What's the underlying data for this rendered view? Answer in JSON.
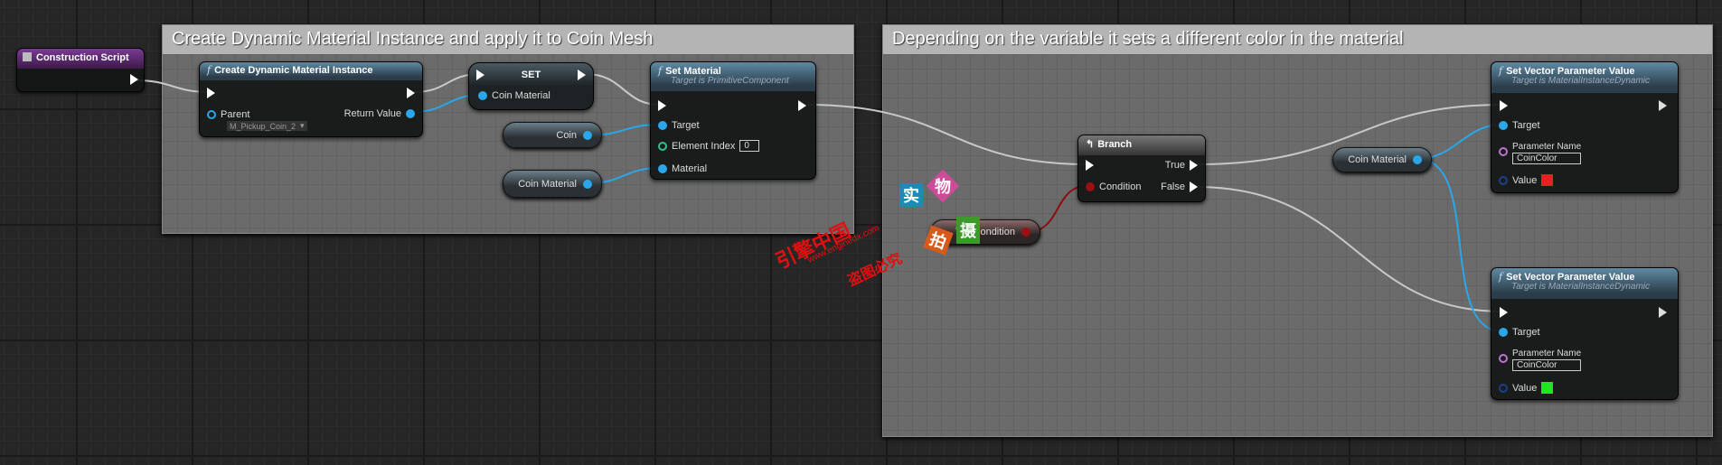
{
  "comments": [
    {
      "title": "Create Dynamic Material Instance and apply it to Coin Mesh"
    },
    {
      "title": "Depending on the variable it sets a different color in the material"
    }
  ],
  "nodes": {
    "construction_script": {
      "title": "Construction Script",
      "color": "#6a2a82"
    },
    "create_dmi": {
      "title": "Create Dynamic Material Instance",
      "parent_label": "Parent",
      "parent_value": "M_Pickup_Coin_2",
      "return_label": "Return Value"
    },
    "set": {
      "title": "SET",
      "pin": "Coin Material"
    },
    "coin_var": {
      "label": "Coin"
    },
    "coin_material_var": {
      "label": "Coin Material"
    },
    "set_material": {
      "title": "Set Material",
      "subtitle": "Target is PrimitiveComponent",
      "target": "Target",
      "element_index": "Element Index",
      "element_index_value": "0",
      "material": "Material"
    },
    "branch": {
      "title": "Branch",
      "true": "True",
      "false": "False",
      "condition": "Condition"
    },
    "var_condition": {
      "label": "Var Condition"
    },
    "coin_material_var2": {
      "label": "Coin Material"
    },
    "svpv_red": {
      "title": "Set Vector Parameter Value",
      "subtitle": "Target is MaterialInstanceDynamic",
      "target": "Target",
      "param_label": "Parameter Name",
      "param_value": "CoinColor",
      "value_label": "Value",
      "value_color": "#e52222"
    },
    "svpv_green": {
      "title": "Set Vector Parameter Value",
      "subtitle": "Target is MaterialInstanceDynamic",
      "target": "Target",
      "param_label": "Parameter Name",
      "param_value": "CoinColor",
      "value_label": "Value",
      "value_color": "#22e522"
    }
  },
  "watermark": {
    "site": "www.enginedx.com",
    "brand": "引擎中国",
    "notice": "盗图必究",
    "chars": [
      "实",
      "物",
      "拍",
      "摄"
    ]
  },
  "colors": {
    "exec_wire": "#c8c8c8",
    "object_wire": "#2aa7e8",
    "bool_wire": "#8b1010"
  }
}
